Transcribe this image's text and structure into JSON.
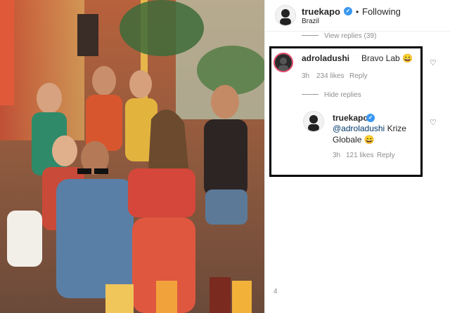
{
  "header": {
    "username": "truekapo",
    "separator": "•",
    "follow_label": "Following",
    "location": "Brazil"
  },
  "view_replies": "View replies (39)",
  "comment": {
    "username": "adroladushi",
    "text": "Bravo Lab 😄",
    "time": "3h",
    "likes": "234 likes",
    "reply_label": "Reply",
    "hide_replies": "Hide replies"
  },
  "reply": {
    "username": "truekapo",
    "mention": "@adroladushi",
    "text_line1": " Krize",
    "text_line2": "Globale 😄",
    "time": "3h",
    "likes": "121 likes",
    "reply_label": "Reply"
  },
  "footer_count": "4",
  "colors": {
    "verified_blue": "#3897f0",
    "mention": "#00376b"
  }
}
